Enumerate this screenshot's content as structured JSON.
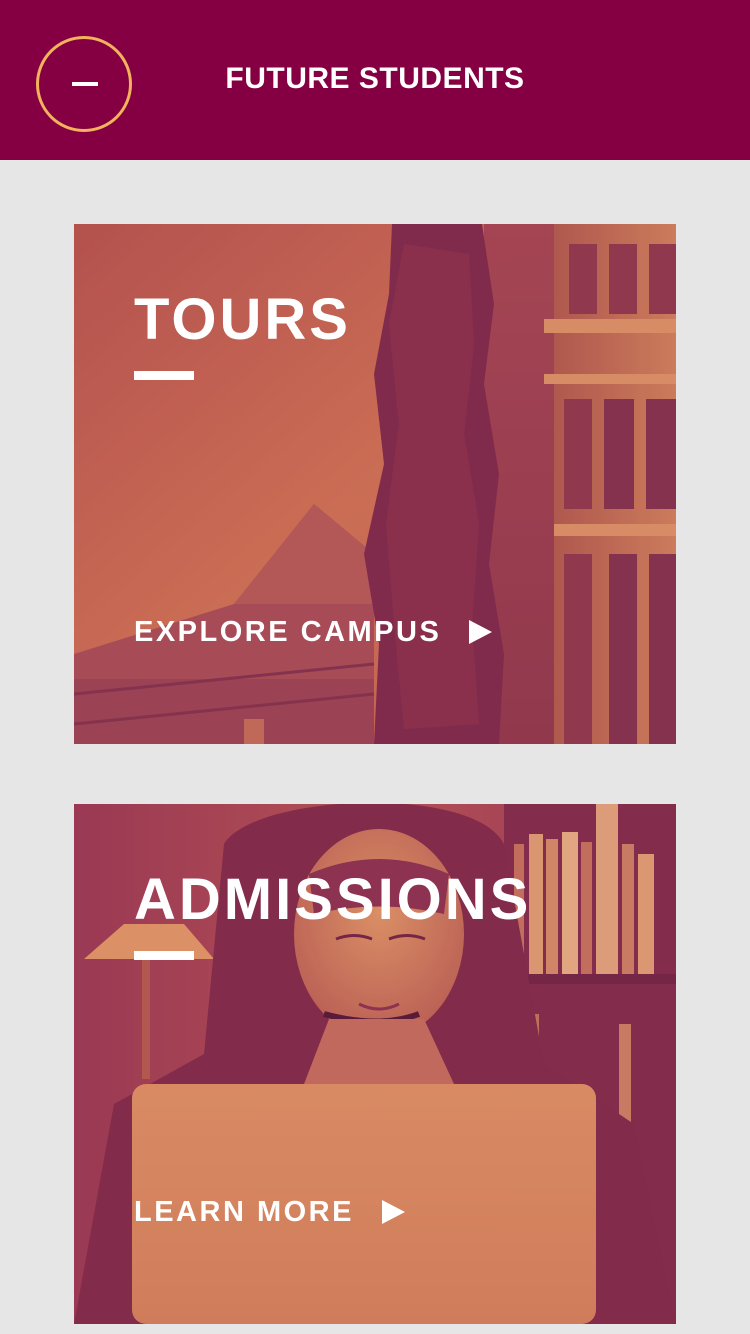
{
  "header": {
    "title": "FUTURE STUDENTS",
    "menu_icon": "minus-icon",
    "menu_ring_color": "#f2b35c",
    "background_color": "#850042"
  },
  "cards": [
    {
      "title": "TOURS",
      "link_label": "EXPLORE CAMPUS",
      "link_icon": "play-arrow-icon",
      "image": "campus-building-with-ivy"
    },
    {
      "title": "ADMISSIONS",
      "link_label": "LEARN MORE",
      "link_icon": "play-arrow-icon",
      "image": "student-with-laptop-in-library"
    }
  ],
  "colors": {
    "overlay_dark": "#8a1f4f",
    "overlay_light": "#e0905a",
    "page_background": "#e6e6e6"
  }
}
